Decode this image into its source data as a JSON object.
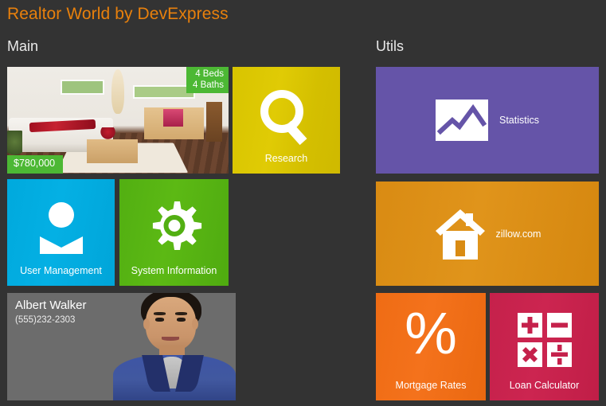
{
  "app": {
    "title": "Realtor World by DevExpress",
    "accent_color": "#e8800c",
    "background_color": "#333333"
  },
  "groups": {
    "main": {
      "title": "Main"
    },
    "utils": {
      "title": "Utils"
    }
  },
  "main_tiles": {
    "property": {
      "beds": "4 Beds",
      "baths": "4 Baths",
      "price": "$780,000",
      "badge_color": "#4cb834",
      "icon": "property-photo"
    },
    "research": {
      "label": "Research",
      "icon": "magnifier-icon",
      "color": "#d8c400"
    },
    "user_management": {
      "label": "User Management",
      "icon": "user-icon",
      "color": "#00a9dd"
    },
    "system_information": {
      "label": "System Information",
      "icon": "gear-icon",
      "color": "#52af12"
    },
    "contact": {
      "name": "Albert Walker",
      "phone": "(555)232-2303",
      "icon": "contact-photo",
      "color": "#6c6c6c"
    }
  },
  "utils_tiles": {
    "statistics": {
      "label": "Statistics",
      "icon": "chart-icon",
      "color": "#6554a8"
    },
    "zillow": {
      "label": "zillow.com",
      "icon": "house-icon",
      "color": "#d98b13"
    },
    "mortgage_rates": {
      "label": "Mortgage Rates",
      "icon": "percent-icon",
      "symbol": "%",
      "color": "#ef6c14"
    },
    "loan_calculator": {
      "label": "Loan Calculator",
      "icon": "calculator-icon",
      "keys": [
        "+",
        "−",
        "×",
        "÷"
      ],
      "color": "#c5214b"
    }
  }
}
